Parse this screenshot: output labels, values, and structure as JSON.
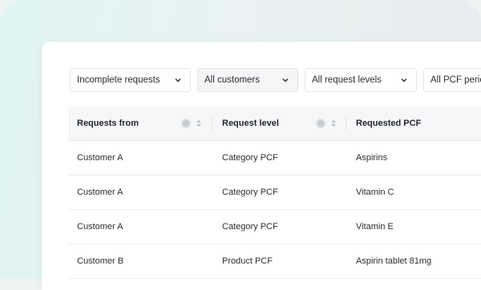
{
  "filters": [
    {
      "label": "Incomplete requests",
      "selected": false
    },
    {
      "label": "All customers",
      "selected": true
    },
    {
      "label": "All request levels",
      "selected": false
    },
    {
      "label": "All PCF perio",
      "selected": false
    }
  ],
  "table": {
    "columns": [
      "Requests from",
      "Request level",
      "Requested PCF"
    ],
    "rows": [
      [
        "Customer A",
        "Category PCF",
        "Aspirins"
      ],
      [
        "Customer A",
        "Category PCF",
        "Vitamin C"
      ],
      [
        "Customer A",
        "Category PCF",
        "Vitamin E"
      ],
      [
        "Customer B",
        "Product PCF",
        "Aspirin tablet 81mg"
      ]
    ]
  },
  "colors": {
    "header_bg": "#f6f7f8",
    "selected_filter_bg": "#f4f5f6",
    "text": "#2a2d31"
  }
}
